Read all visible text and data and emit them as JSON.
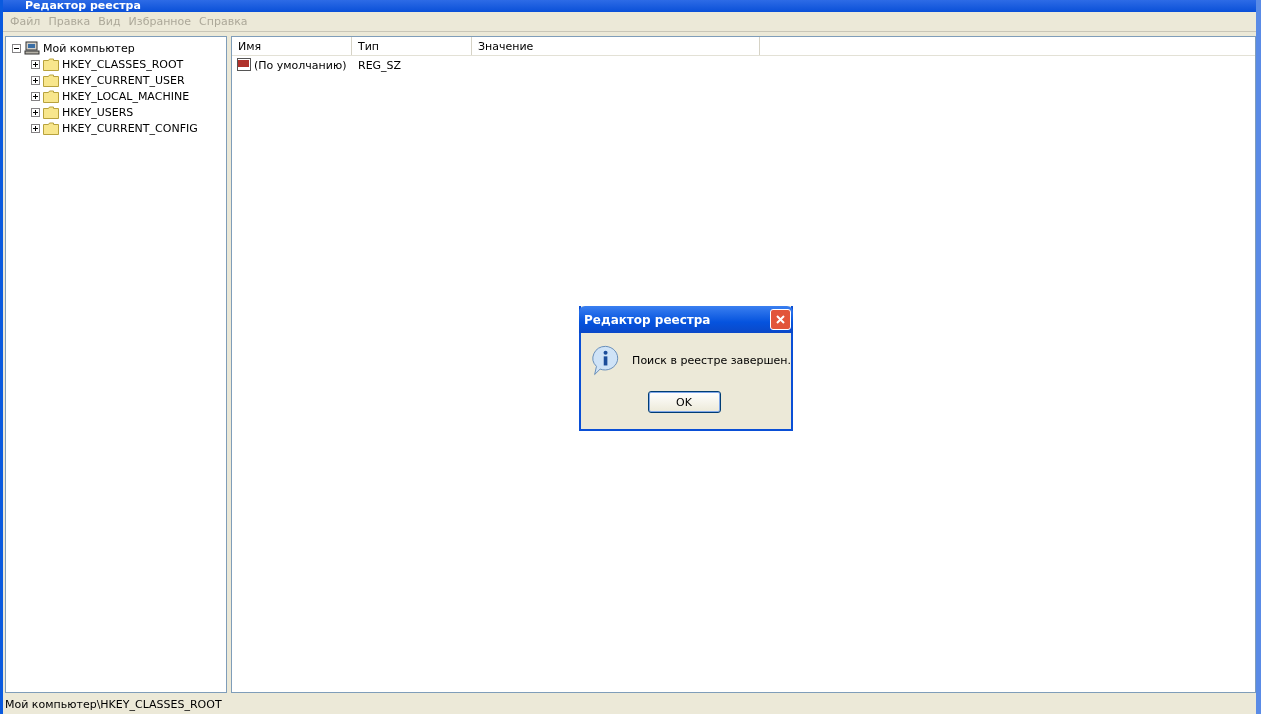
{
  "window": {
    "title": "Редактор реестра"
  },
  "menu": [
    {
      "label": "Файл",
      "disabled": true
    },
    {
      "label": "Правка",
      "disabled": true
    },
    {
      "label": "Вид",
      "disabled": true
    },
    {
      "label": "Избранное",
      "disabled": true
    },
    {
      "label": "Справка",
      "disabled": true
    }
  ],
  "tree": [
    {
      "label": "Мой компьютер",
      "kind": "computer",
      "expanded": true,
      "children": [
        {
          "label": "HKEY_CLASSES_ROOT",
          "kind": "folder",
          "expanded": false
        },
        {
          "label": "HKEY_CURRENT_USER",
          "kind": "folder",
          "expanded": false
        },
        {
          "label": "HKEY_LOCAL_MACHINE",
          "kind": "folder",
          "expanded": false
        },
        {
          "label": "HKEY_USERS",
          "kind": "folder",
          "expanded": false
        },
        {
          "label": "HKEY_CURRENT_CONFIG",
          "kind": "folder",
          "expanded": false
        }
      ]
    }
  ],
  "table": {
    "columns": [
      "Имя",
      "Тип",
      "Значение"
    ],
    "rows": [
      {
        "name": "(По умолчанию)",
        "type": "REG_SZ"
      }
    ]
  },
  "dialog": {
    "title": "Редактор реестра",
    "message": "Поиск в реестре завершен.",
    "button": "OK"
  },
  "status_bar": "Мой компьютер\\HKEY_CLASSES_ROOT"
}
